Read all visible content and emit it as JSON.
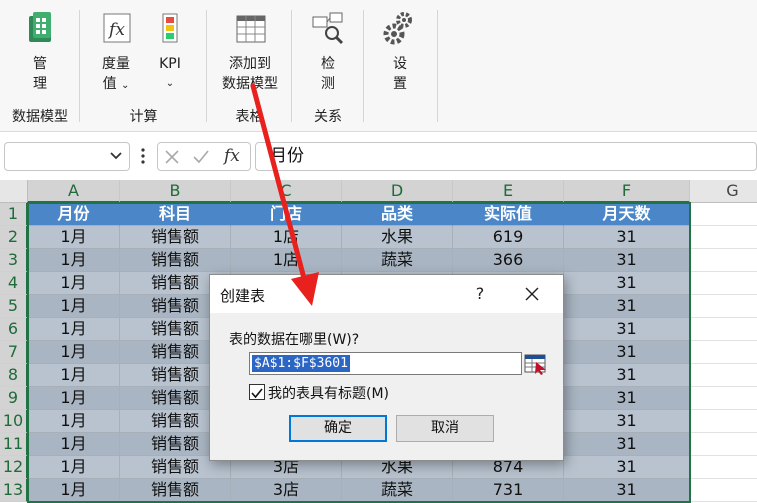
{
  "ribbon": {
    "groups": [
      {
        "label": "数据模型",
        "buttons": [
          {
            "label1": "管",
            "label2": "理",
            "icon": "data-model-manage-icon"
          }
        ]
      },
      {
        "label": "计算",
        "buttons": [
          {
            "label1": "度量",
            "label2": "值",
            "dropdown": true,
            "icon": "measure-fx-icon"
          },
          {
            "label1": "KPI",
            "label2": "",
            "dropdown": true,
            "icon": "kpi-icon"
          }
        ]
      },
      {
        "label": "表格",
        "buttons": [
          {
            "label1": "添加到",
            "label2": "数据模型",
            "icon": "add-to-model-icon"
          }
        ]
      },
      {
        "label": "关系",
        "buttons": [
          {
            "label1": "检",
            "label2": "测",
            "icon": "detect-icon"
          }
        ]
      },
      {
        "label": "",
        "buttons": [
          {
            "label1": "设",
            "label2": "置",
            "icon": "settings-gear-icon"
          }
        ]
      }
    ]
  },
  "formula_bar": {
    "name_box": "",
    "fx": "fx",
    "value": "月份"
  },
  "sheet": {
    "columns": [
      "A",
      "B",
      "C",
      "D",
      "E",
      "F",
      "G"
    ],
    "rows": [
      "1",
      "2",
      "3",
      "4",
      "5",
      "6",
      "7",
      "8",
      "9",
      "10",
      "11",
      "12",
      "13"
    ],
    "header": [
      "月份",
      "科目",
      "门店",
      "品类",
      "实际值",
      "月天数"
    ],
    "data": [
      [
        "1月",
        "销售额",
        "1店",
        "水果",
        "619",
        "31"
      ],
      [
        "1月",
        "销售额",
        "1店",
        "蔬菜",
        "366",
        "31"
      ],
      [
        "1月",
        "销售额",
        "",
        "",
        "",
        "31"
      ],
      [
        "1月",
        "销售额",
        "",
        "",
        "",
        "31"
      ],
      [
        "1月",
        "销售额",
        "",
        "",
        "",
        "31"
      ],
      [
        "1月",
        "销售额",
        "",
        "",
        "",
        "31"
      ],
      [
        "1月",
        "销售额",
        "",
        "",
        "",
        "31"
      ],
      [
        "1月",
        "销售额",
        "",
        "",
        "",
        "31"
      ],
      [
        "1月",
        "销售额",
        "",
        "",
        "",
        "31"
      ],
      [
        "1月",
        "销售额",
        "",
        "",
        "",
        "31"
      ],
      [
        "1月",
        "销售额",
        "3店",
        "水果",
        "874",
        "31"
      ],
      [
        "1月",
        "销售额",
        "3店",
        "蔬菜",
        "731",
        "31"
      ]
    ]
  },
  "dialog": {
    "title": "创建表",
    "help": "?",
    "prompt": "表的数据在哪里(W)?",
    "range": "$A$1:$F$3601",
    "has_headers_label": "我的表具有标题(M)",
    "has_headers_checked": true,
    "ok": "确定",
    "cancel": "取消"
  },
  "colors": {
    "header_fill": "#4a86c8",
    "band_odd": "#b8c3cf",
    "band_even": "#a9b5c2",
    "selection": "#217346",
    "annotation_arrow": "#e8211e"
  }
}
